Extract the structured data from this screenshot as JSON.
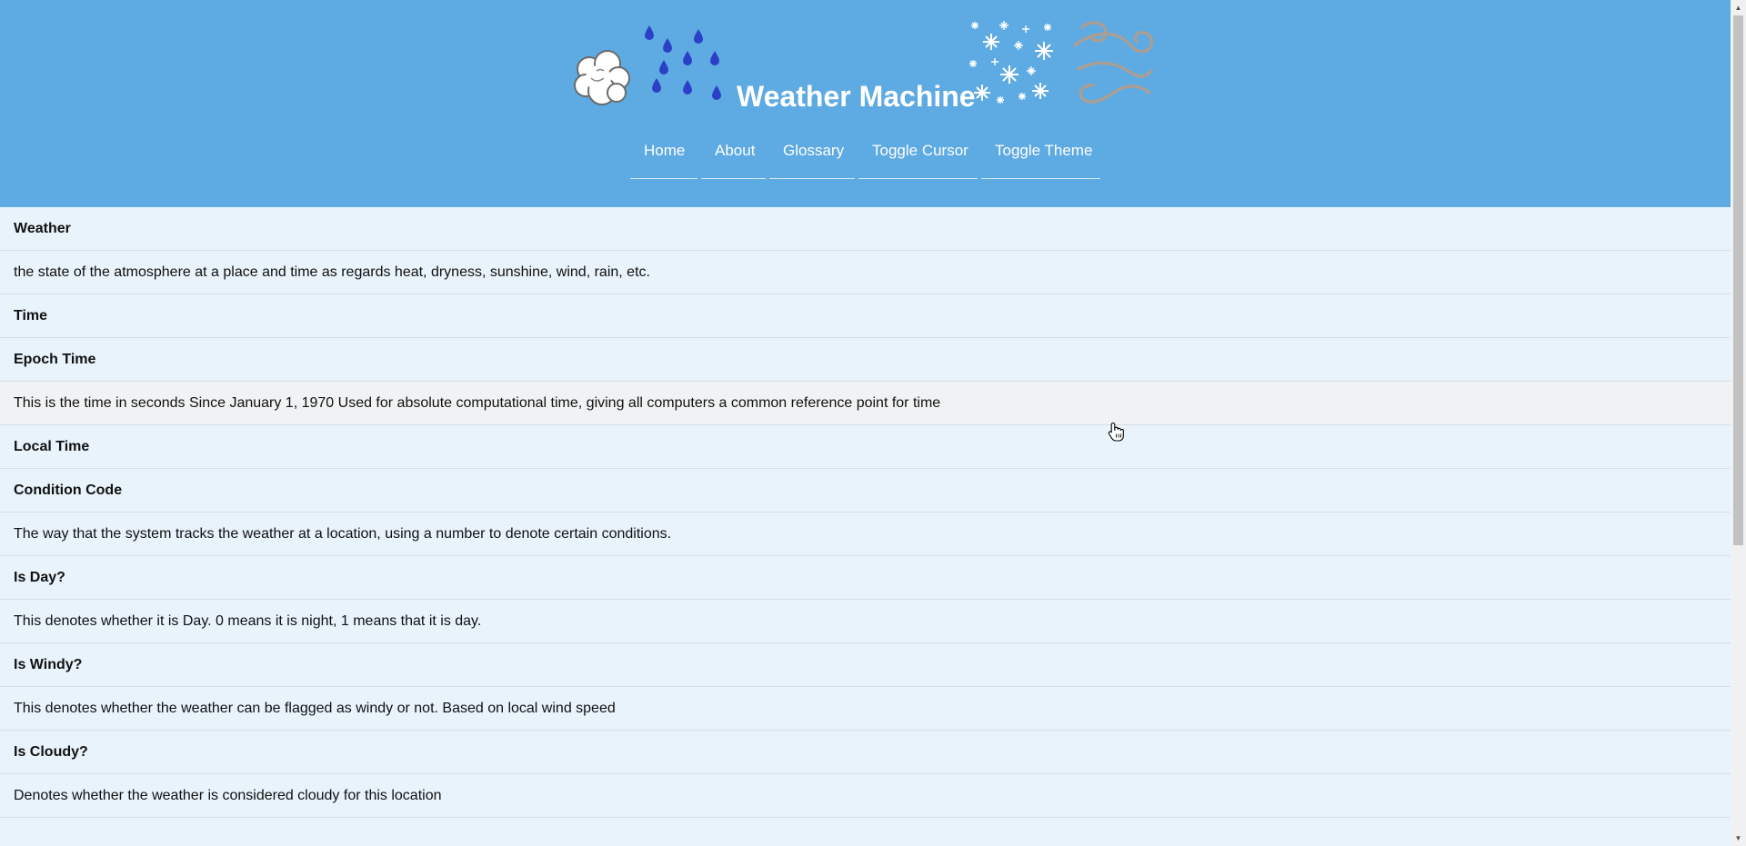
{
  "header": {
    "title": "Weather Machine",
    "icons": [
      "cloud-icon",
      "rain-icon",
      "snow-icon",
      "wind-icon"
    ]
  },
  "nav": {
    "items": [
      {
        "label": "Home"
      },
      {
        "label": "About"
      },
      {
        "label": "Glossary"
      },
      {
        "label": "Toggle Cursor"
      },
      {
        "label": "Toggle Theme"
      }
    ]
  },
  "glossary": {
    "rows": [
      {
        "kind": "term",
        "text": "Weather"
      },
      {
        "kind": "definition",
        "text": "the state of the atmosphere at a place and time as regards heat, dryness, sunshine, wind, rain, etc."
      },
      {
        "kind": "term",
        "text": "Time"
      },
      {
        "kind": "term",
        "text": "Epoch Time"
      },
      {
        "kind": "definition",
        "text": "This is the time in seconds Since January 1, 1970 Used for absolute computational time, giving all computers a common reference point for time"
      },
      {
        "kind": "term",
        "text": "Local Time"
      },
      {
        "kind": "term",
        "text": "Condition Code"
      },
      {
        "kind": "definition",
        "text": "The way that the system tracks the weather at a location, using a number to denote certain conditions."
      },
      {
        "kind": "term",
        "text": "Is Day?"
      },
      {
        "kind": "definition",
        "text": "This denotes whether it is Day. 0 means it is night, 1 means that it is day."
      },
      {
        "kind": "term",
        "text": "Is Windy?"
      },
      {
        "kind": "definition",
        "text": "This denotes whether the weather can be flagged as windy or not. Based on local wind speed"
      },
      {
        "kind": "term",
        "text": "Is Cloudy?"
      },
      {
        "kind": "definition",
        "text": "Denotes whether the weather is considered cloudy for this location"
      }
    ]
  },
  "colors": {
    "header_bg": "#5eaae2",
    "page_bg": "#e8f3fb",
    "row_hover": "#f1f2f3",
    "rain": "#2c3fc7",
    "wind": "#a99e96"
  }
}
